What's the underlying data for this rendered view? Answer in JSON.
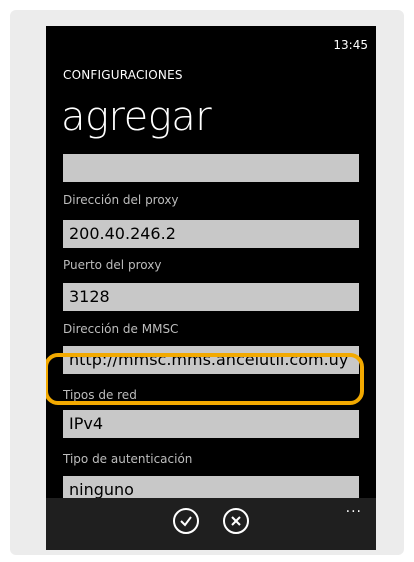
{
  "status": {
    "time": "13:45"
  },
  "header": {
    "app_title": "CONFIGURACIONES",
    "page_title": "agregar"
  },
  "fields": [
    {
      "label": "",
      "value": ""
    },
    {
      "label": "Dirección del proxy",
      "value": "200.40.246.2"
    },
    {
      "label": "Puerto del proxy",
      "value": "3128"
    },
    {
      "label": "Dirección de MMSC",
      "value": "http://mmsc.mms.ancelutil.com.uy"
    },
    {
      "label": "Tipos de red",
      "value": "IPv4"
    },
    {
      "label": "Tipo de autenticación",
      "value": "ninguno"
    }
  ],
  "app_bar": {
    "buttons": [
      "check-icon",
      "close-icon"
    ],
    "more": "..."
  },
  "colors": {
    "highlight": "#f2a900",
    "field_bg": "#c8c8c8",
    "background": "#000000"
  }
}
